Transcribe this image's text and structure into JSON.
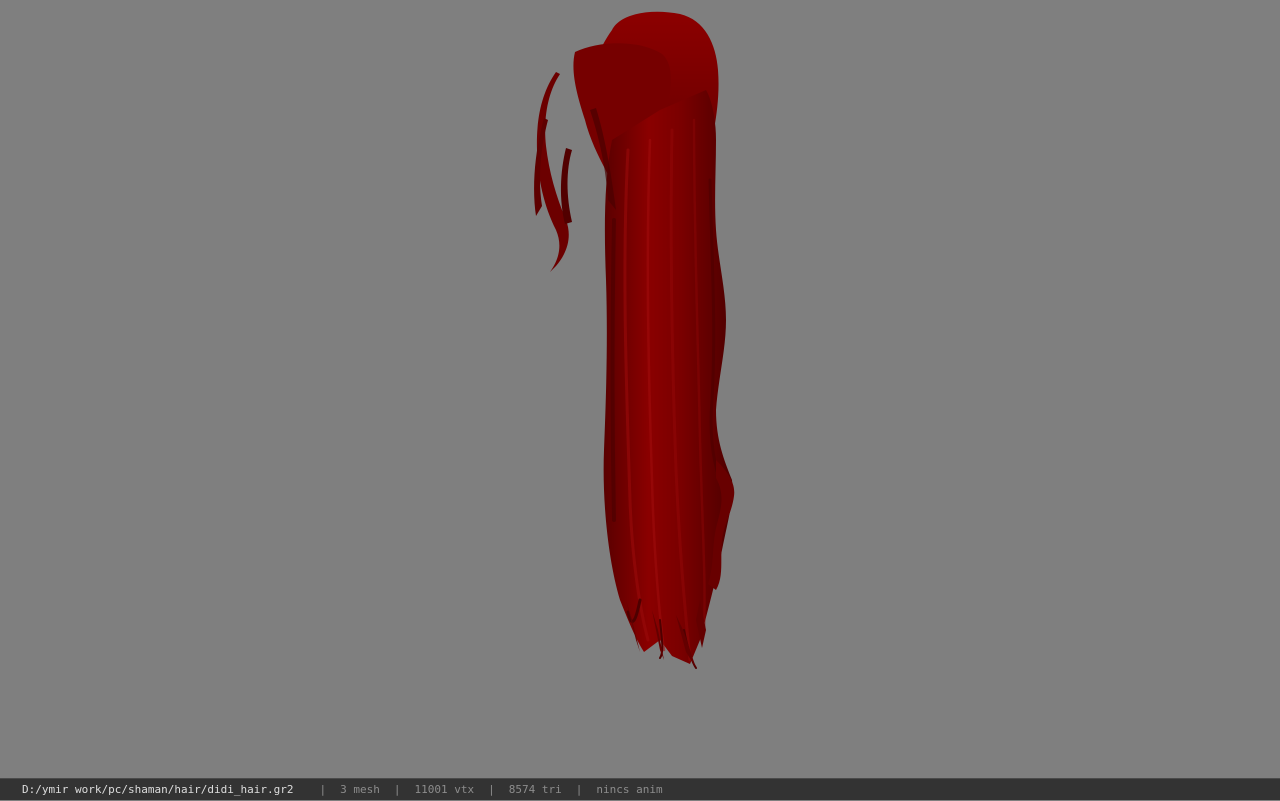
{
  "viewport": {
    "background_color": "#7f7f7f",
    "model_color": "#7a0000",
    "model_name": "didi_hair"
  },
  "status_bar": {
    "file_path": "D:/ymir work/pc/shaman/hair/didi_hair.gr2",
    "separator": "|",
    "mesh_count": "3 mesh",
    "vertex_count": "11001 vtx",
    "triangle_count": "8574 tri",
    "anim_status": "nincs anim"
  }
}
